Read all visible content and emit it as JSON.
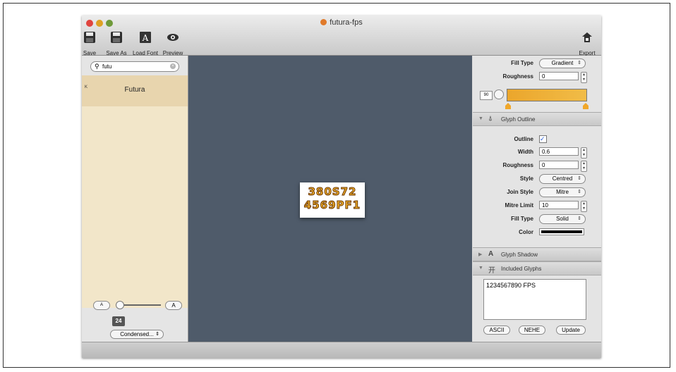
{
  "window": {
    "title": "futura-fps"
  },
  "toolbar": {
    "save_label": "Save",
    "save_as_label": "Save As",
    "load_font_label": "Load Font",
    "preview_label": "Preview",
    "export_label": "Export"
  },
  "sidebar": {
    "search_value": "futu",
    "font_name": "Futura",
    "size_value": "24",
    "style_select": "Condensed...",
    "small_a": "A",
    "large_a": "A"
  },
  "canvas": {
    "preview_line1": "380S72",
    "preview_line2": "4569PF1"
  },
  "fill": {
    "fill_type_label": "Fill Type",
    "fill_type_value": "Gradient",
    "roughness_label": "Roughness",
    "roughness_value": "0",
    "angle_value": "90",
    "gradient_color": "#f0b43c"
  },
  "outline": {
    "section_title": "Glyph Outline",
    "outline_label": "Outline",
    "outline_checked": true,
    "width_label": "Width",
    "width_value": "0.6",
    "roughness_label": "Roughness",
    "roughness_value": "0",
    "style_label": "Style",
    "style_value": "Centred",
    "join_style_label": "Join Style",
    "join_style_value": "Mitre",
    "mitre_limit_label": "Mitre Limit",
    "mitre_limit_value": "10",
    "fill_type_label": "Fill Type",
    "fill_type_value": "Solid",
    "color_label": "Color",
    "color_value": "#000000"
  },
  "shadow": {
    "section_title": "Glyph Shadow"
  },
  "included": {
    "section_title": "Included Glyphs",
    "glyphs_text": "1234567890 FPS",
    "ascii_label": "ASCII",
    "nehe_label": "NEHE",
    "update_label": "Update"
  }
}
